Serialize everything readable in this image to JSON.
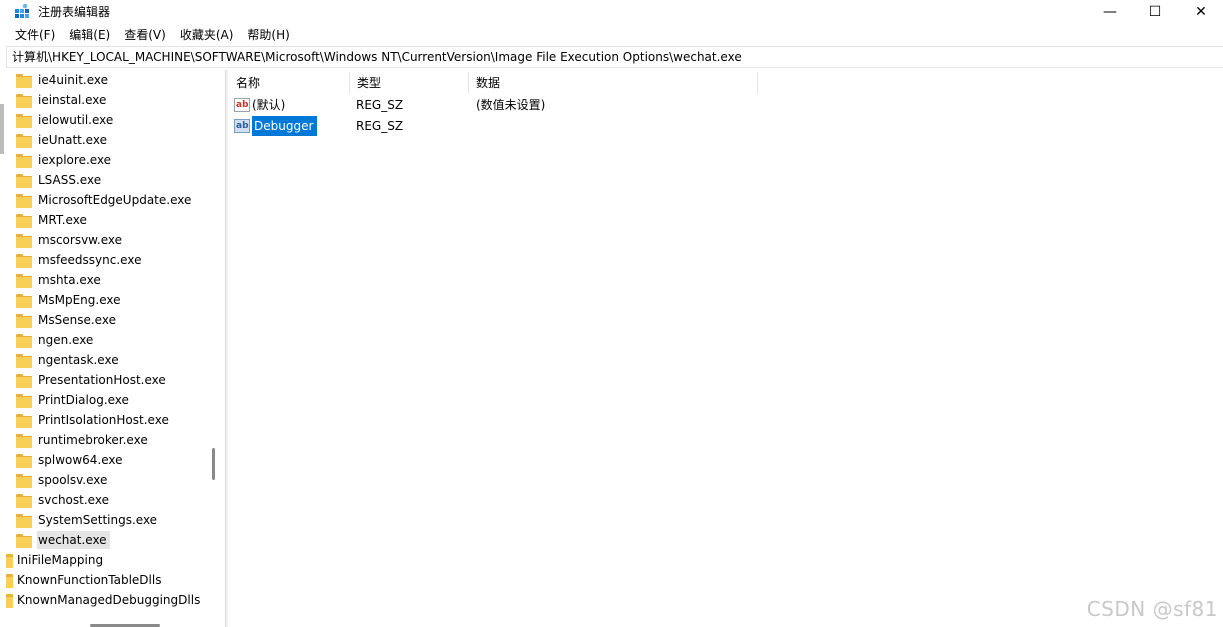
{
  "window": {
    "title": "注册表编辑器",
    "minimize_glyph": "—",
    "maximize_glyph": "☐",
    "close_glyph": "✕"
  },
  "menu": [
    "文件(F)",
    "编辑(E)",
    "查看(V)",
    "收藏夹(A)",
    "帮助(H)"
  ],
  "address": "计算机\\HKEY_LOCAL_MACHINE\\SOFTWARE\\Microsoft\\Windows NT\\CurrentVersion\\Image File Execution Options\\wechat.exe",
  "tree": {
    "children": [
      "ie4uinit.exe",
      "ieinstal.exe",
      "ielowutil.exe",
      "ieUnatt.exe",
      "iexplore.exe",
      "LSASS.exe",
      "MicrosoftEdgeUpdate.exe",
      "MRT.exe",
      "mscorsvw.exe",
      "msfeedssync.exe",
      "mshta.exe",
      "MsMpEng.exe",
      "MsSense.exe",
      "ngen.exe",
      "ngentask.exe",
      "PresentationHost.exe",
      "PrintDialog.exe",
      "PrintIsolationHost.exe",
      "runtimebroker.exe",
      "splwow64.exe",
      "spoolsv.exe",
      "svchost.exe",
      "SystemSettings.exe",
      "wechat.exe"
    ],
    "selected": "wechat.exe",
    "siblings": [
      "IniFileMapping",
      "KnownFunctionTableDlls",
      "KnownManagedDebuggingDlls"
    ]
  },
  "list": {
    "columns": {
      "name": "名称",
      "type": "类型",
      "data": "数据"
    },
    "rows": [
      {
        "name": "(默认)",
        "type": "REG_SZ",
        "data": "(数值未设置)",
        "icon": "string-value-icon",
        "selected": false
      },
      {
        "name": "Debugger",
        "type": "REG_SZ",
        "data": "",
        "icon": "string-value-icon",
        "selected": true
      }
    ],
    "icon_glyph": "ab"
  },
  "watermark": "CSDN @sf81",
  "colors": {
    "selection": "#0078d7",
    "folder": "#f8cf57",
    "tree_selected": "#e5e5e5"
  }
}
